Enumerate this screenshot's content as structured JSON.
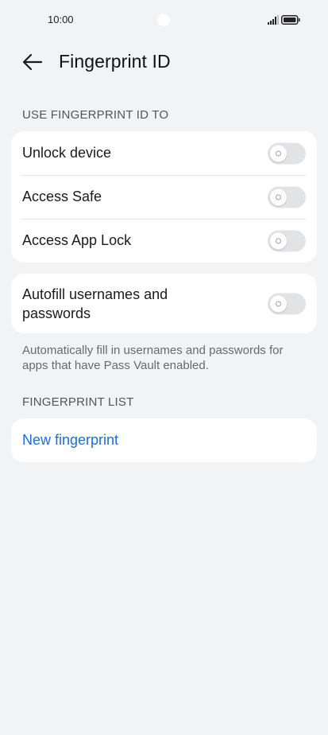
{
  "status_bar": {
    "time": "10:00",
    "icons": [
      "signal-icon",
      "battery-icon"
    ]
  },
  "header": {
    "back_icon": "arrow-left-icon",
    "title": "Fingerprint ID"
  },
  "section_use": {
    "label": "USE FINGERPRINT ID TO",
    "items": [
      {
        "label": "Unlock device",
        "enabled": false
      },
      {
        "label": "Access Safe",
        "enabled": false
      },
      {
        "label": "Access App Lock",
        "enabled": false
      }
    ]
  },
  "autofill": {
    "label": "Autofill usernames and passwords",
    "enabled": false,
    "description": "Automatically fill in usernames and passwords for apps that have Pass Vault enabled."
  },
  "section_list": {
    "label": "FINGERPRINT LIST",
    "new_fingerprint": "New fingerprint"
  },
  "colors": {
    "background": "#f1f3f5",
    "link": "#1a6fd8",
    "toggle_off": "#e2e3e5"
  }
}
